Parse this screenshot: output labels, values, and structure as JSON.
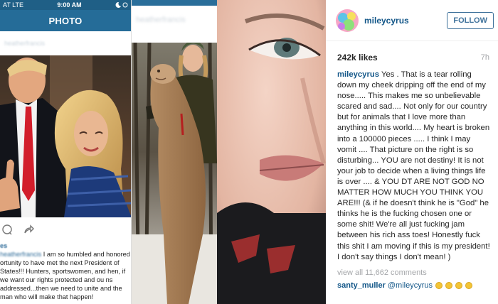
{
  "left_screenshot": {
    "status_bar": {
      "carrier": "AT LTE",
      "time": "9:00 AM"
    },
    "nav_title": "PHOTO",
    "poster_name": "heatherfrancis",
    "caption_line1": "es",
    "caption_text": "I am so humbled and honored ortunity to have met the next President of States!!! Hunters, sportswomen, and hen, if we want our rights protected and ou ns addressed...then we need to unite and the man who will make that happen!",
    "caption_user": "heatherfrancis"
  },
  "middle_photo": {
    "poster_name": "heatherfrancis"
  },
  "post": {
    "username": "mileycyrus",
    "follow_label": "FOLLOW",
    "likes": "242k likes",
    "time_ago": "7h",
    "caption_user": "mileycyrus",
    "caption_text": " Yes . That is a tear rolling down my cheek dripping off the end of my nose..... This makes me so unbelievable scared and sad.... Not only for our country but for animals that I love more than anything in this world.... My heart is broken into a 100000 pieces ..... I think I may vomit .... That picture on the right is so disturbing... YOU are not destiny! It is not your job to decide when a living things life is over .... & YOU DT ARE NOT GOD NO MATTER HOW MUCH YOU THINK YOU ARE!!! (& if he doesn't think he is \"God\" he thinks he is the fucking chosen one or some shit! We're all just fucking jam between his rich ass toes! Honestly fuck this shit I am moving if this is my president! I don't say things I don't mean! )",
    "view_all": "view all 11,662 comments",
    "comment_user": "santy_muller",
    "comment_text": "@mileycyrus",
    "comment_emojis": [
      "crying-face",
      "crying-face",
      "crying-face",
      "crying-face"
    ]
  },
  "colors": {
    "nav_blue": "#256c98",
    "username_blue": "#125688",
    "follow_border": "#3f729b"
  }
}
